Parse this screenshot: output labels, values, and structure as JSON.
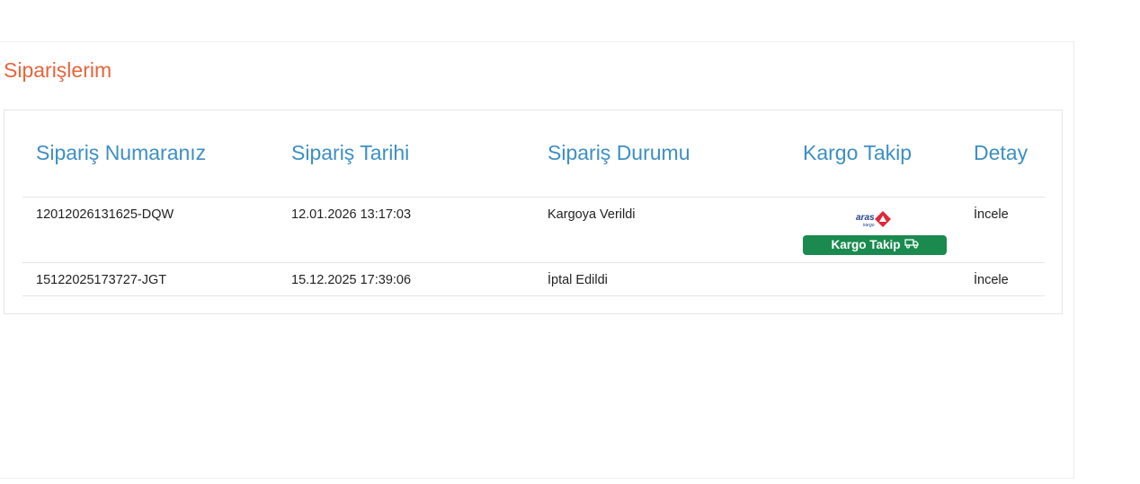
{
  "page": {
    "title": "Siparişlerim"
  },
  "table": {
    "headers": {
      "order_no": "Sipariş Numaranız",
      "order_date": "Sipariş Tarihi",
      "order_status": "Sipariş Durumu",
      "cargo": "Kargo Takip",
      "detail": "Detay"
    },
    "rows": [
      {
        "order_no": "12012026131625-DQW",
        "order_date": "12.01.2026 13:17:03",
        "order_status": "Kargoya Verildi",
        "carrier_logo_text": "aras",
        "carrier_logo_subtext": "kargo",
        "cargo_button": "Kargo Takip",
        "cargo_icon": "truck-icon",
        "detail": "İncele"
      },
      {
        "order_no": "15122025173727-JGT",
        "order_date": "15.12.2025 17:39:06",
        "order_status": "İptal Edildi",
        "detail": "İncele"
      }
    ]
  },
  "colors": {
    "title": "#e8643a",
    "header": "#3d8fc4",
    "cargo_button_bg": "#1a8a4f",
    "logo_blue": "#1f3f8f",
    "logo_red": "#e0283a"
  }
}
